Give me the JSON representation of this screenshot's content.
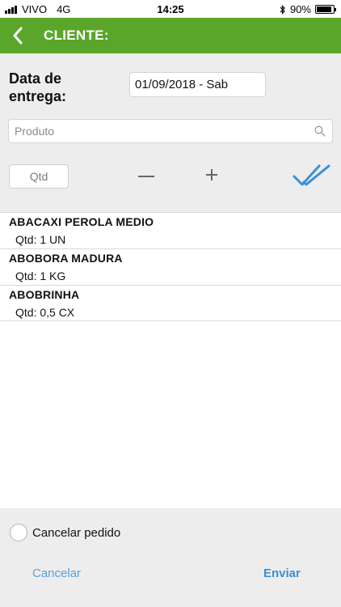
{
  "status_bar": {
    "carrier": "VIVO",
    "network": "4G",
    "time": "14:25",
    "battery": "90%",
    "battery_level": 0.9,
    "icons": [
      "signal-icon",
      "bluetooth-icon",
      "battery-icon"
    ]
  },
  "header": {
    "title": "CLIENTE:",
    "back_icon": "chevron-left-icon",
    "color": "#5aa62b"
  },
  "form": {
    "date_label": "Data de entrega:",
    "date_value": "01/09/2018 - Sab",
    "search_placeholder": "Produto",
    "search_icon": "search-icon",
    "qty_placeholder": "Qtd",
    "minus_icon": "minus-icon",
    "plus_icon": "plus-icon",
    "confirm_icon": "double-check-icon"
  },
  "items": [
    {
      "name": "ABACAXI PEROLA MEDIO",
      "qty": "Qtd: 1 UN"
    },
    {
      "name": "ABOBORA MADURA",
      "qty": "Qtd: 1 KG"
    },
    {
      "name": "ABOBRINHA",
      "qty": "Qtd: 0,5 CX"
    }
  ],
  "footer": {
    "cancel_order_label": "Cancelar pedido",
    "cancel_button": "Cancelar",
    "send_button": "Enviar",
    "accent_color": "#3b8fd4"
  }
}
